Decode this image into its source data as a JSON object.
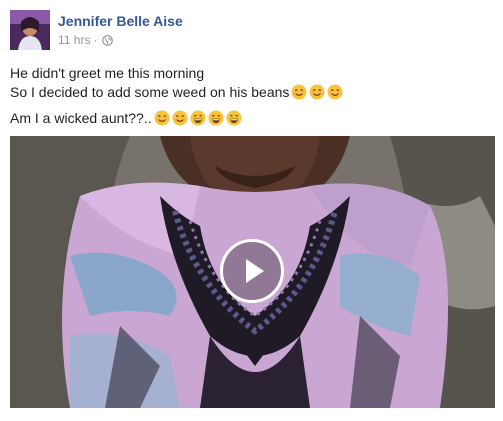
{
  "post": {
    "author": "Jennifer Belle Aise",
    "time": "11 hrs",
    "separator": "·",
    "privacy_icon": "globe-icon",
    "lines": [
      "He didn't greet me this morning",
      "So I decided to add some weed on his beans",
      "Am I a wicked aunt??.."
    ],
    "line2_emojis": [
      "smiling-face-icon",
      "smiling-face-icon",
      "smiling-face-icon"
    ],
    "line3_emojis": [
      "smiling-face-icon",
      "smiling-face-icon",
      "grinning-face-icon",
      "grinning-face-icon",
      "grinning-face-icon"
    ]
  },
  "video": {
    "play_icon": "play-icon"
  },
  "colors": {
    "author": "#365899",
    "meta": "#90949c",
    "text": "#1d2129",
    "emoji": "#f7c33b"
  }
}
